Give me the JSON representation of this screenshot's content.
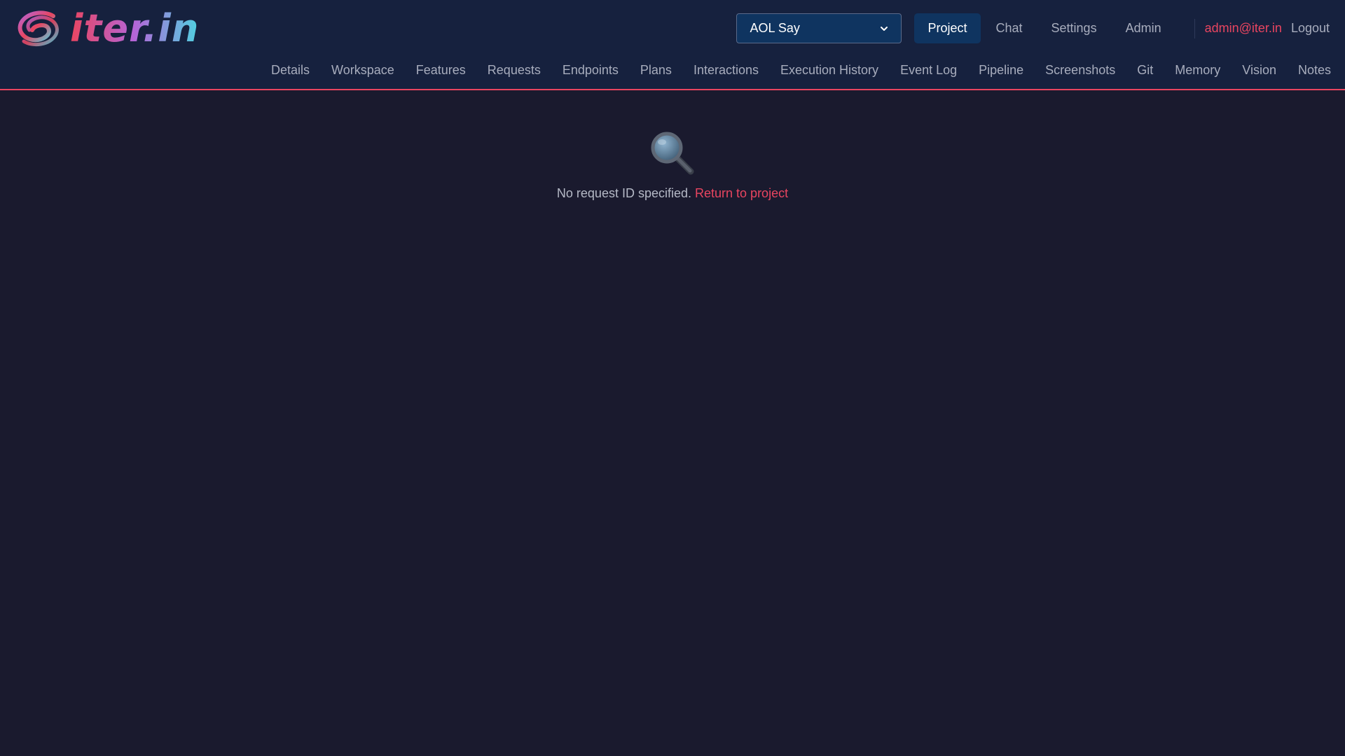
{
  "brand": {
    "name": "iter.in",
    "logo_icon": "swirl-logo-icon"
  },
  "header": {
    "project_select": {
      "value": "AOL Say",
      "icon": "chevron-down-icon"
    },
    "nav": [
      {
        "label": "Project",
        "active": true
      },
      {
        "label": "Chat",
        "active": false
      },
      {
        "label": "Settings",
        "active": false
      },
      {
        "label": "Admin",
        "active": false
      }
    ],
    "user_email": "admin@iter.in",
    "logout_label": "Logout"
  },
  "subnav": [
    "Details",
    "Workspace",
    "Features",
    "Requests",
    "Endpoints",
    "Plans",
    "Interactions",
    "Execution History",
    "Event Log",
    "Pipeline",
    "Screenshots",
    "Git",
    "Memory",
    "Vision",
    "Notes"
  ],
  "empty_state": {
    "icon": "magnifying-glass-icon",
    "message": "No request ID specified.",
    "link_label": "Return to project"
  },
  "colors": {
    "background": "#1a1a2e",
    "header_background": "#16213e",
    "accent": "#e94560",
    "active_nav": "#0f3460",
    "muted_text": "#a8adbd"
  }
}
